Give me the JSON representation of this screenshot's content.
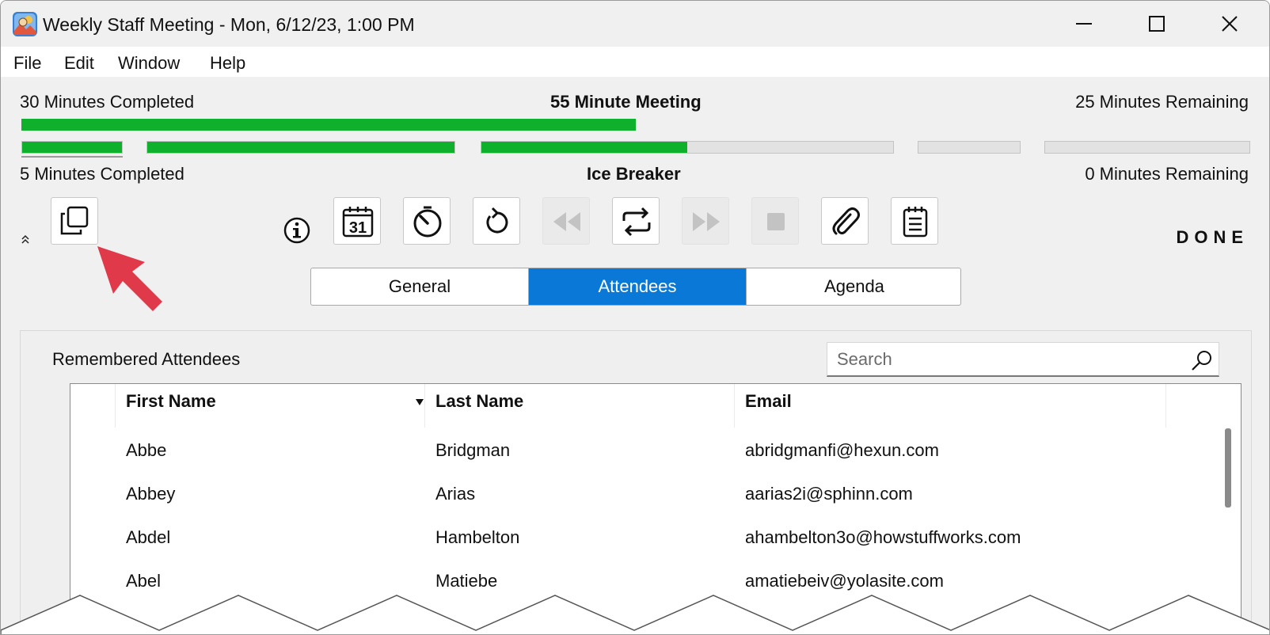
{
  "window": {
    "title": "Weekly Staff Meeting - Mon, 6/12/23, 1:00 PM"
  },
  "menu": [
    "File",
    "Edit",
    "Window",
    "Help"
  ],
  "meeting": {
    "completed": "30 Minutes Completed",
    "title": "55 Minute Meeting",
    "remaining": "25 Minutes Remaining",
    "progress": 0.545
  },
  "agenda_item": {
    "completed": "5 Minutes Completed",
    "title": "Ice Breaker",
    "remaining": "0 Minutes Remaining",
    "segments_progress": [
      1.0,
      1.0,
      0.5,
      0.0,
      0.0
    ]
  },
  "toolbar": {
    "buttons": [
      {
        "icon": "copy-icon",
        "enabled": true
      },
      {
        "icon": "info-icon",
        "enabled": true
      },
      {
        "icon": "calendar-icon",
        "label": "31",
        "enabled": true
      },
      {
        "icon": "timer-icon",
        "enabled": true
      },
      {
        "icon": "reset-icon",
        "enabled": true
      },
      {
        "icon": "rewind-icon",
        "enabled": false
      },
      {
        "icon": "repeat-icon",
        "enabled": true
      },
      {
        "icon": "fast-forward-icon",
        "enabled": false
      },
      {
        "icon": "stop-icon",
        "enabled": false
      },
      {
        "icon": "paperclip-icon",
        "enabled": true
      },
      {
        "icon": "notepad-icon",
        "enabled": true
      }
    ],
    "done_label": "DONE"
  },
  "tabs": [
    {
      "label": "General",
      "active": false
    },
    {
      "label": "Attendees",
      "active": true
    },
    {
      "label": "Agenda",
      "active": false
    }
  ],
  "attendees_panel": {
    "title": "Remembered Attendees",
    "search_placeholder": "Search",
    "columns": [
      "First Name",
      "Last Name",
      "Email"
    ],
    "sort_column": "First Name",
    "rows": [
      {
        "first": "Abbe",
        "last": "Bridgman",
        "email": "abridgmanfi@hexun.com"
      },
      {
        "first": "Abbey",
        "last": "Arias",
        "email": "aarias2i@sphinn.com"
      },
      {
        "first": "Abdel",
        "last": "Hambelton",
        "email": "ahambelton3o@howstuffworks.com"
      },
      {
        "first": "Abel",
        "last": "Matiebe",
        "email": "amatiebeiv@yolasite.com"
      }
    ]
  },
  "colors": {
    "progress": "#0fb12c",
    "accent": "#0a78d7",
    "annotation_arrow": "#e03a4a"
  }
}
